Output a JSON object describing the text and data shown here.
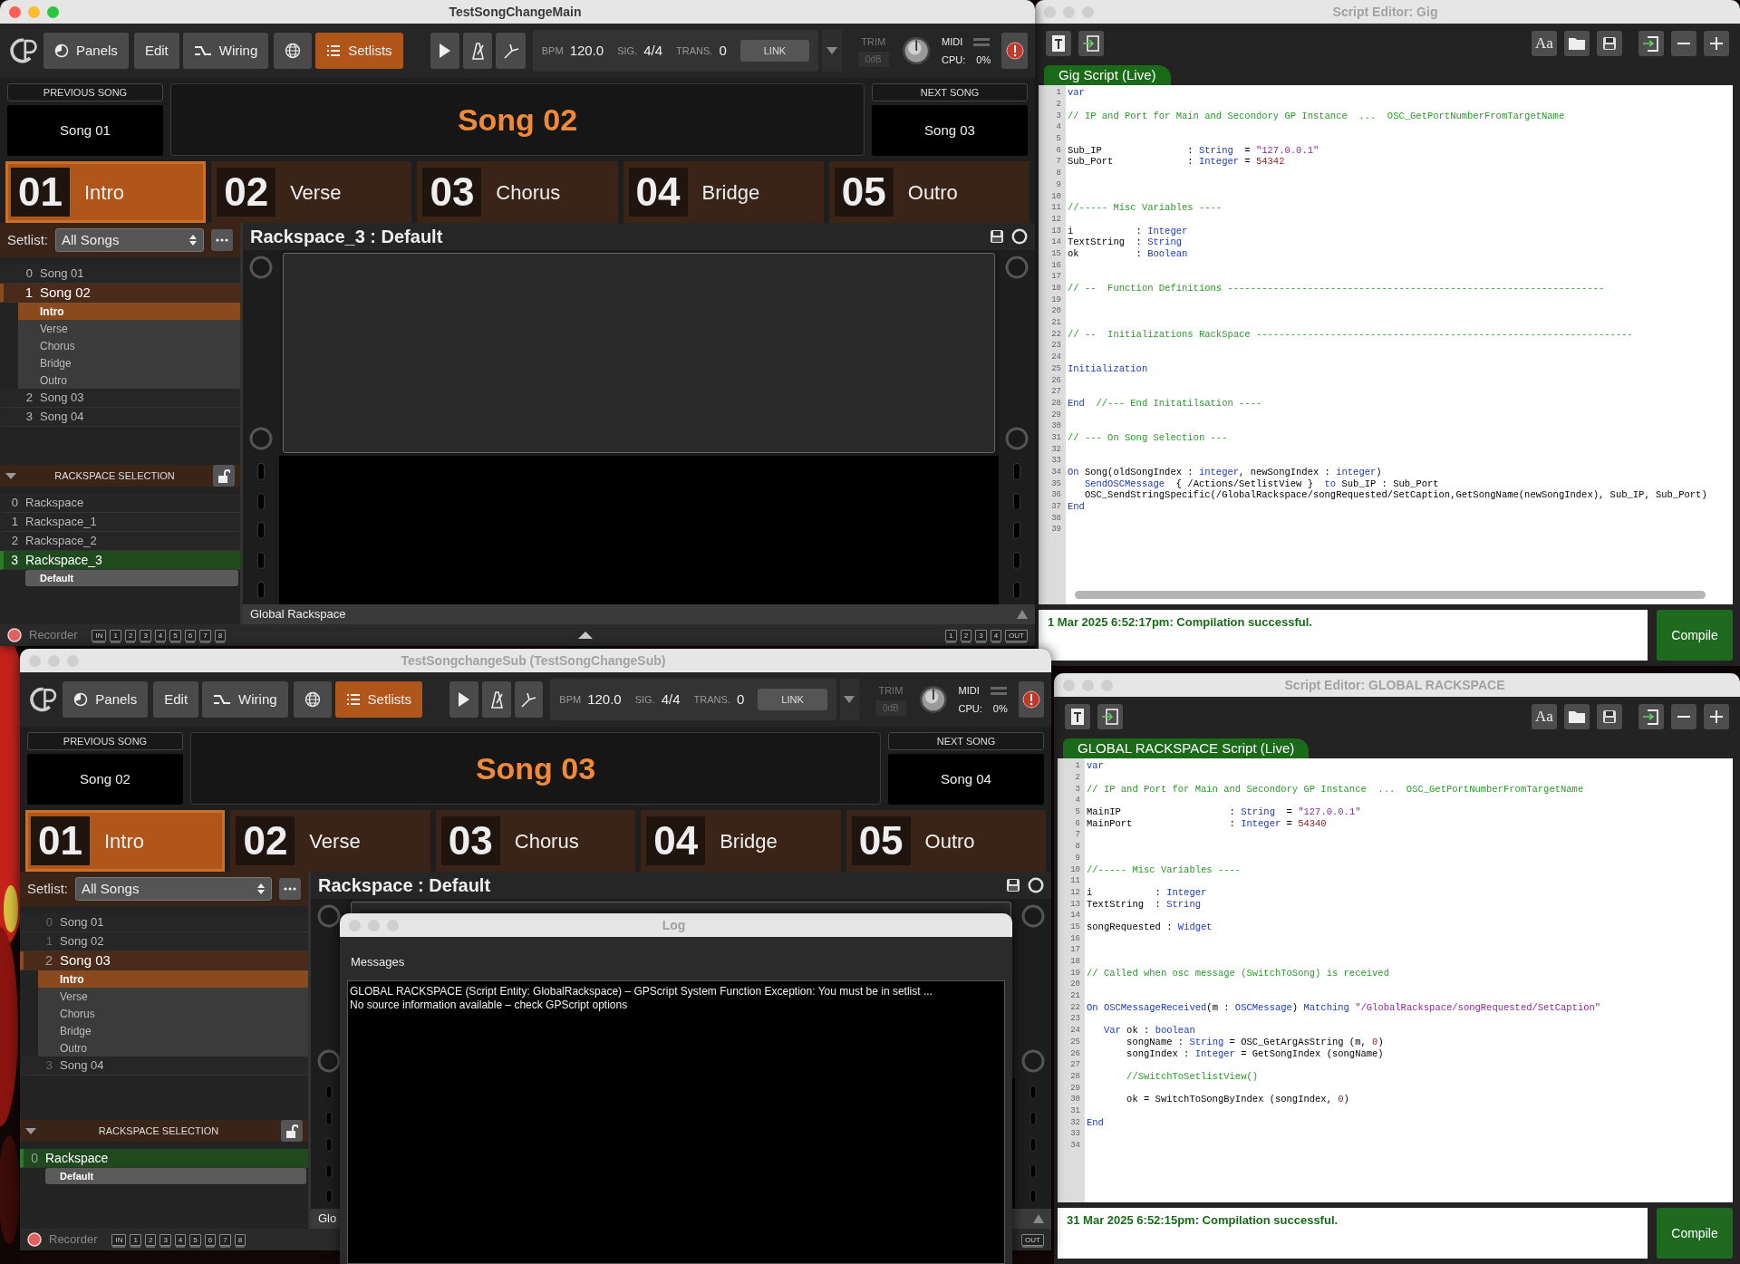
{
  "gig_script_editor": {
    "title": "Script Editor:  Gig",
    "active": false,
    "font_button": "Aa",
    "tab": "Gig Script (Live)",
    "lines": [
      {
        "number": "1",
        "tokens": [
          {
            "kind": "keyword",
            "text": "var"
          }
        ]
      },
      {
        "number": "2"
      },
      {
        "number": "3",
        "tokens": [
          {
            "kind": "comment",
            "text": "// IP and Port for Main and Secondory GP Instance  ...  OSC_GetPortNumberFromTargetName"
          }
        ]
      },
      {
        "number": "4"
      },
      {
        "number": "5"
      },
      {
        "number": "6",
        "tokens": [
          {
            "kind": "plain",
            "text": "Sub_IP               : "
          },
          {
            "kind": "keyword",
            "text": "String"
          },
          {
            "kind": "plain",
            "text": "  = "
          },
          {
            "kind": "string",
            "text": "\"127.0.0.1\""
          }
        ]
      },
      {
        "number": "7",
        "tokens": [
          {
            "kind": "plain",
            "text": "Sub_Port             : "
          },
          {
            "kind": "keyword",
            "text": "Integer"
          },
          {
            "kind": "plain",
            "text": " = "
          },
          {
            "kind": "number",
            "text": "54342"
          }
        ]
      },
      {
        "number": "8"
      },
      {
        "number": "9"
      },
      {
        "number": "10"
      },
      {
        "number": "11",
        "tokens": [
          {
            "kind": "comment",
            "text": "//----- Misc Variables ----"
          }
        ]
      },
      {
        "number": "12"
      },
      {
        "number": "13",
        "tokens": [
          {
            "kind": "plain",
            "text": "i           : "
          },
          {
            "kind": "keyword",
            "text": "Integer"
          }
        ]
      },
      {
        "number": "14",
        "tokens": [
          {
            "kind": "plain",
            "text": "TextString  : "
          },
          {
            "kind": "keyword",
            "text": "String"
          }
        ]
      },
      {
        "number": "15",
        "tokens": [
          {
            "kind": "plain",
            "text": "ok          : "
          },
          {
            "kind": "keyword",
            "text": "Boolean"
          }
        ]
      },
      {
        "number": "16"
      },
      {
        "number": "17"
      },
      {
        "number": "18",
        "tokens": [
          {
            "kind": "comment",
            "text": "// --  Function Definitions ------------------------------------------------------------------"
          }
        ]
      },
      {
        "number": "19"
      },
      {
        "number": "20"
      },
      {
        "number": "21"
      },
      {
        "number": "22",
        "tokens": [
          {
            "kind": "comment",
            "text": "// --  Initializations RackSpace ------------------------------------------------------------------"
          }
        ]
      },
      {
        "number": "23"
      },
      {
        "number": "24"
      },
      {
        "number": "25",
        "tokens": [
          {
            "kind": "keyword",
            "text": "Initialization"
          }
        ]
      },
      {
        "number": "26"
      },
      {
        "number": "27"
      },
      {
        "number": "28",
        "tokens": [
          {
            "kind": "keyword",
            "text": "End"
          },
          {
            "kind": "comment",
            "text": "  //--- End Initatilsation ----"
          }
        ]
      },
      {
        "number": "29"
      },
      {
        "number": "30"
      },
      {
        "number": "31",
        "tokens": [
          {
            "kind": "comment",
            "text": "// --- On Song Selection ---"
          }
        ]
      },
      {
        "number": "32"
      },
      {
        "number": "33"
      },
      {
        "number": "34",
        "tokens": [
          {
            "kind": "keyword",
            "text": "On"
          },
          {
            "kind": "plain",
            "text": " Song(oldSongIndex : "
          },
          {
            "kind": "keyword",
            "text": "integer"
          },
          {
            "kind": "plain",
            "text": ", newSongIndex : "
          },
          {
            "kind": "keyword",
            "text": "integer"
          },
          {
            "kind": "plain",
            "text": ")"
          }
        ]
      },
      {
        "number": "35",
        "tokens": [
          {
            "kind": "keyword",
            "text": "   SendOSCMessage"
          },
          {
            "kind": "plain",
            "text": "  { /Actions/SetlistView }  "
          },
          {
            "kind": "keyword",
            "text": "to"
          },
          {
            "kind": "plain",
            "text": " Sub_IP : Sub_Port"
          }
        ]
      },
      {
        "number": "36",
        "tokens": [
          {
            "kind": "plain",
            "text": "   OSC_SendStringSpecific(/GlobalRackspace/songRequested/SetCaption,GetSongName(newSongIndex), Sub_IP, Sub_Port)"
          }
        ]
      },
      {
        "number": "37",
        "tokens": [
          {
            "kind": "keyword",
            "text": "End"
          }
        ]
      },
      {
        "number": "38"
      },
      {
        "number": "39"
      }
    ],
    "scrollbar": true,
    "status": "1 Mar 2025 6:52:17pm: Compilation successful.",
    "compile": "Compile"
  },
  "main_window": {
    "title": "TestSongChangeMain",
    "active": true,
    "toolbar": {
      "buttons": [
        {
          "kind": "panels",
          "label": "Panels",
          "selected": false
        },
        {
          "kind": "edit",
          "label": "Edit",
          "selected": false
        },
        {
          "kind": "wiring",
          "label": "Wiring",
          "selected": false
        },
        {
          "kind": "globe",
          "selected": false
        },
        {
          "kind": "setlists",
          "label": "Setlists",
          "selected": true
        }
      ],
      "bpm_label": "BPM",
      "bpm": "120.0",
      "sig_label": "SIG.",
      "sig": "4/4",
      "trans_label": "TRANS.",
      "trans": "0",
      "link": "LINK",
      "trim_label": "TRIM",
      "trim": "0dB",
      "midi": "MIDI",
      "cpu_label": "CPU:",
      "cpu": "0%"
    },
    "previous_song": {
      "label": "PREVIOUS SONG",
      "name": "Song 01"
    },
    "current_song": "Song 02",
    "next_song": {
      "label": "NEXT SONG",
      "name": "Song 03"
    },
    "parts": [
      {
        "number": "01",
        "name": "Intro",
        "selected": true
      },
      {
        "number": "02",
        "name": "Verse",
        "selected": false
      },
      {
        "number": "03",
        "name": "Chorus",
        "selected": false
      },
      {
        "number": "04",
        "name": "Bridge",
        "selected": false
      },
      {
        "number": "05",
        "name": "Outro",
        "selected": false
      }
    ],
    "setlist": {
      "label": "Setlist:",
      "value": "All Songs"
    },
    "songs": [
      {
        "index": "0",
        "name": "Song 01",
        "selected": false
      },
      {
        "index": "1",
        "name": "Song 02",
        "selected": true,
        "children": [
          {
            "name": "Intro",
            "selected": true
          },
          {
            "name": "Verse",
            "selected": false
          },
          {
            "name": "Chorus",
            "selected": false
          },
          {
            "name": "Bridge",
            "selected": false
          },
          {
            "name": "Outro",
            "selected": false
          }
        ]
      },
      {
        "index": "2",
        "name": "Song 03",
        "selected": false
      },
      {
        "index": "3",
        "name": "Song 04",
        "selected": false
      }
    ],
    "rackspace_header": "RACKSPACE SELECTION",
    "rackspaces": [
      {
        "index": "0",
        "name": "Rackspace",
        "selected": false
      },
      {
        "index": "1",
        "name": "Rackspace_1",
        "selected": false
      },
      {
        "index": "2",
        "name": "Rackspace_2",
        "selected": false
      },
      {
        "index": "3",
        "name": "Rackspace_3",
        "selected": true,
        "children": [
          {
            "name": "Default",
            "selected": true
          }
        ]
      }
    ],
    "rackspace_title": "Rackspace_3 : Default",
    "global_rackspace": "Global Rackspace",
    "recorder": {
      "label": "Recorder",
      "inputs": [
        "IN",
        "1",
        "2",
        "3",
        "4",
        "5",
        "6",
        "7",
        "8"
      ],
      "outputs": [
        "1",
        "2",
        "3",
        "4",
        "OUT"
      ]
    }
  },
  "global_script_editor": {
    "title": "Script Editor:  GLOBAL RACKSPACE",
    "active": false,
    "font_button": "Aa",
    "tab": "GLOBAL RACKSPACE Script (Live)",
    "lines": [
      {
        "number": "1",
        "tokens": [
          {
            "kind": "keyword",
            "text": "var"
          }
        ]
      },
      {
        "number": "2"
      },
      {
        "number": "3",
        "tokens": [
          {
            "kind": "comment",
            "text": "// IP and Port for Main and Secondory GP Instance  ...  OSC_GetPortNumberFromTargetName"
          }
        ]
      },
      {
        "number": "4"
      },
      {
        "number": "5",
        "tokens": [
          {
            "kind": "plain",
            "text": "MainIP                   : "
          },
          {
            "kind": "keyword",
            "text": "String"
          },
          {
            "kind": "plain",
            "text": "  = "
          },
          {
            "kind": "string",
            "text": "\"127.0.0.1\""
          }
        ]
      },
      {
        "number": "6",
        "tokens": [
          {
            "kind": "plain",
            "text": "MainPort                 : "
          },
          {
            "kind": "keyword",
            "text": "Integer"
          },
          {
            "kind": "plain",
            "text": " = "
          },
          {
            "kind": "number",
            "text": "54340"
          }
        ]
      },
      {
        "number": "7"
      },
      {
        "number": "8"
      },
      {
        "number": "9"
      },
      {
        "number": "10",
        "tokens": [
          {
            "kind": "comment",
            "text": "//----- Misc Variables ----"
          }
        ]
      },
      {
        "number": "11"
      },
      {
        "number": "12",
        "tokens": [
          {
            "kind": "plain",
            "text": "i           : "
          },
          {
            "kind": "keyword",
            "text": "Integer"
          }
        ]
      },
      {
        "number": "13",
        "tokens": [
          {
            "kind": "plain",
            "text": "TextString  : "
          },
          {
            "kind": "keyword",
            "text": "String"
          }
        ]
      },
      {
        "number": "14"
      },
      {
        "number": "15",
        "tokens": [
          {
            "kind": "plain",
            "text": "songRequested : "
          },
          {
            "kind": "keyword",
            "text": "Widget"
          }
        ]
      },
      {
        "number": "16"
      },
      {
        "number": "17"
      },
      {
        "number": "18"
      },
      {
        "number": "19",
        "tokens": [
          {
            "kind": "comment",
            "text": "// Called when osc message (SwitchToSong) is received"
          }
        ]
      },
      {
        "number": "20"
      },
      {
        "number": "21"
      },
      {
        "number": "22",
        "tokens": [
          {
            "kind": "keyword",
            "text": "On OSCMessageReceived"
          },
          {
            "kind": "plain",
            "text": "(m : "
          },
          {
            "kind": "keyword",
            "text": "OSCMessage"
          },
          {
            "kind": "plain",
            "text": ") "
          },
          {
            "kind": "keyword",
            "text": "Matching "
          },
          {
            "kind": "string",
            "text": "\"/GlobalRackspace/songRequested/SetCaption\""
          }
        ]
      },
      {
        "number": "23"
      },
      {
        "number": "24",
        "tokens": [
          {
            "kind": "keyword",
            "text": "   Var"
          },
          {
            "kind": "plain",
            "text": " ok : "
          },
          {
            "kind": "keyword",
            "text": "boolean"
          }
        ]
      },
      {
        "number": "25",
        "tokens": [
          {
            "kind": "plain",
            "text": "       songName : "
          },
          {
            "kind": "keyword",
            "text": "String"
          },
          {
            "kind": "plain",
            "text": " = OSC_GetArgAsString (m, "
          },
          {
            "kind": "number",
            "text": "0"
          },
          {
            "kind": "plain",
            "text": ")"
          }
        ]
      },
      {
        "number": "26",
        "tokens": [
          {
            "kind": "plain",
            "text": "       songIndex : "
          },
          {
            "kind": "keyword",
            "text": "Integer"
          },
          {
            "kind": "plain",
            "text": " = GetSongIndex (songName)"
          }
        ]
      },
      {
        "number": "27"
      },
      {
        "number": "28",
        "tokens": [
          {
            "kind": "comment",
            "text": "       //SwitchToSetlistView()"
          }
        ]
      },
      {
        "number": "29"
      },
      {
        "number": "30",
        "tokens": [
          {
            "kind": "plain",
            "text": "       ok = SwitchToSongByIndex (songIndex, "
          },
          {
            "kind": "number",
            "text": "0"
          },
          {
            "kind": "plain",
            "text": ")"
          }
        ]
      },
      {
        "number": "31"
      },
      {
        "number": "32",
        "tokens": [
          {
            "kind": "keyword",
            "text": "End"
          }
        ]
      },
      {
        "number": "33"
      },
      {
        "number": "34"
      }
    ],
    "status": "31 Mar 2025 6:52:15pm: Compilation successful.",
    "compile": "Compile"
  },
  "sub_window": {
    "title": "TestSongchangeSub (TestSongChangeSub)",
    "active": false,
    "toolbar": {
      "buttons": [
        {
          "kind": "panels",
          "label": "Panels",
          "selected": false
        },
        {
          "kind": "edit",
          "label": "Edit",
          "selected": false
        },
        {
          "kind": "wiring",
          "label": "Wiring",
          "selected": false
        },
        {
          "kind": "globe",
          "selected": false
        },
        {
          "kind": "setlists",
          "label": "Setlists",
          "selected": true
        }
      ],
      "bpm_label": "BPM",
      "bpm": "120.0",
      "sig_label": "SIG.",
      "sig": "4/4",
      "trans_label": "TRANS.",
      "trans": "0",
      "link": "LINK",
      "trim_label": "TRIM",
      "trim": "0dB",
      "midi": "MIDI",
      "cpu_label": "CPU:",
      "cpu": "0%"
    },
    "previous_song": {
      "label": "PREVIOUS SONG",
      "name": "Song 02"
    },
    "current_song": "Song 03",
    "next_song": {
      "label": "NEXT SONG",
      "name": "Song 04"
    },
    "parts": [
      {
        "number": "01",
        "name": "Intro",
        "selected": true
      },
      {
        "number": "02",
        "name": "Verse",
        "selected": false
      },
      {
        "number": "03",
        "name": "Chorus",
        "selected": false
      },
      {
        "number": "04",
        "name": "Bridge",
        "selected": false
      },
      {
        "number": "05",
        "name": "Outro",
        "selected": false
      }
    ],
    "setlist": {
      "label": "Setlist:",
      "value": "All Songs"
    },
    "songs": [
      {
        "index": "0",
        "name": "Song 01",
        "selected": false
      },
      {
        "index": "1",
        "name": "Song 02",
        "selected": false
      },
      {
        "index": "2",
        "name": "Song 03",
        "selected": true,
        "children": [
          {
            "name": "Intro",
            "selected": true
          },
          {
            "name": "Verse",
            "selected": false
          },
          {
            "name": "Chorus",
            "selected": false
          },
          {
            "name": "Bridge",
            "selected": false
          },
          {
            "name": "Outro",
            "selected": false
          }
        ]
      },
      {
        "index": "3",
        "name": "Song 04",
        "selected": false
      }
    ],
    "rackspace_header": "RACKSPACE SELECTION",
    "rackspaces": [
      {
        "index": "0",
        "name": "Rackspace",
        "selected": true,
        "children": [
          {
            "name": "Default",
            "selected": true
          }
        ]
      }
    ],
    "rackspace_title": "Rackspace : Default",
    "global_rackspace": "Glo",
    "recorder": {
      "label": "Recorder",
      "inputs": [
        "IN",
        "1",
        "2",
        "3",
        "4",
        "5",
        "6",
        "7",
        "8"
      ],
      "outputs": [
        "OUT"
      ]
    }
  },
  "log_window": {
    "title": "Log",
    "active": false,
    "heading": "Messages",
    "lines": [
      "GLOBAL RACKSPACE (Script Entity: GlobalRackspace)  – GPScript System Function Exception: You must be in setlist ...",
      "No source information available – check GPScript options"
    ]
  }
}
